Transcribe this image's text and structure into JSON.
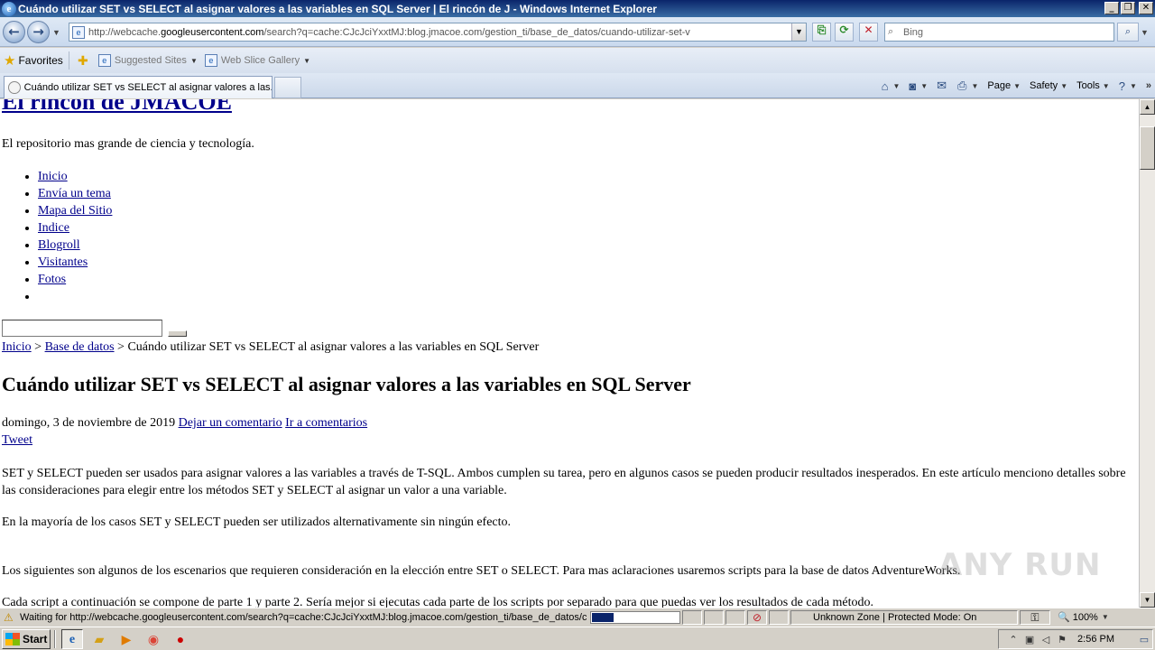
{
  "window": {
    "title": "Cuándo utilizar SET vs SELECT al asignar valores a las variables en SQL Server | El rincón de J - Windows Internet Explorer",
    "buttons": [
      "_",
      "❐",
      "✕"
    ]
  },
  "address_bar": {
    "url_prefix": "http://webcache.",
    "url_domain": "googleusercontent.com",
    "url_rest": "/search?q=cache:CJcJciYxxtMJ:blog.jmacoe.com/gestion_ti/base_de_datos/cuando-utilizar-set-v",
    "search_placeholder": "Bing"
  },
  "favorites_bar": {
    "favorites_label": "Favorites",
    "links": [
      "Suggested Sites",
      "Web Slice Gallery"
    ]
  },
  "tabs": [
    {
      "label": "Cuándo utilizar SET vs SELECT al asignar valores a las..."
    }
  ],
  "command_bar": {
    "page": "Page",
    "safety": "Safety",
    "tools": "Tools",
    "more": "»"
  },
  "page": {
    "site_title": "El rincón de JMACOE",
    "tagline": "El repositorio mas grande de ciencia y tecnología.",
    "nav": [
      "Inicio",
      "Envía un tema",
      "Mapa del Sitio",
      "Indice",
      "Blogroll",
      "Visitantes",
      "Fotos",
      ""
    ],
    "breadcrumb": {
      "home": "Inicio",
      "sep1": " > ",
      "category": "Base de datos",
      "current": " > Cuándo utilizar SET vs SELECT al asignar valores a las variables en SQL Server"
    },
    "post_title": "Cuándo utilizar SET vs SELECT al asignar valores a las variables en SQL Server",
    "meta": {
      "date": "domingo, 3 de noviembre de 2019 ",
      "comment_link": "Dejar un comentario",
      "goto_comments": "Ir a comentarios"
    },
    "tweet": "Tweet",
    "paragraphs": [
      "SET y SELECT pueden ser usados para asignar valores a las variables a través de T-SQL. Ambos cumplen su tarea, pero en algunos casos se pueden producir resultados inesperados. En este artículo menciono detalles sobre las consideraciones para elegir entre los métodos SET y SELECT al asignar un valor a una variable.",
      "En la mayoría de los casos SET y SELECT pueden ser utilizados alternativamente sin ningún efecto.",
      "Los siguientes son algunos de los escenarios que requieren consideración en la elección entre SET o SELECT. Para mas aclaraciones usaremos scripts para la base de datos AdventureWorks.",
      "Cada script a continuación se compone de parte 1 y parte 2. Sería mejor si ejecutas cada parte de los scripts por separado para que puedas ver los resultados de cada método."
    ]
  },
  "watermark": "ANY RUN",
  "status_bar": {
    "text": "Waiting for http://webcache.googleusercontent.com/search?q=cache:CJcJciYxxtMJ:blog.jmacoe.com/gestion_ti/base_de_datos/cu",
    "progress_fraction": 0.25,
    "zone": "Unknown Zone | Protected Mode: On",
    "zoom": "100%"
  },
  "taskbar": {
    "start_label": "Start",
    "clock": "2:56 PM"
  }
}
